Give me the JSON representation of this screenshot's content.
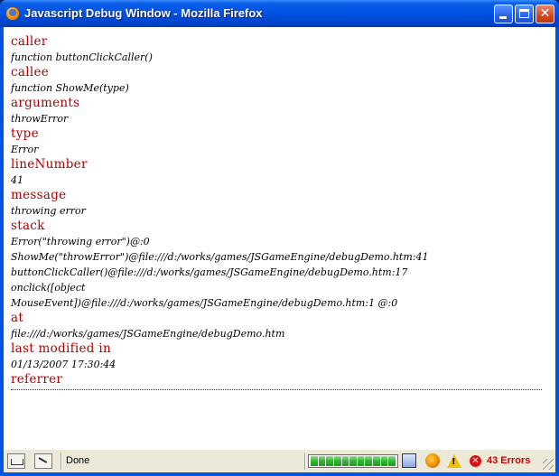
{
  "window": {
    "title": "Javascript Debug Window - Mozilla Firefox",
    "icons": {
      "app": "firefox-icon",
      "minimize": "minimize-icon",
      "maximize": "maximize-icon",
      "close": "close-icon"
    }
  },
  "debug": {
    "entries": [
      {
        "label": "caller",
        "lines": [
          "function buttonClickCaller()"
        ]
      },
      {
        "label": "callee",
        "lines": [
          "function ShowMe(type)"
        ]
      },
      {
        "label": "arguments",
        "lines": [
          "throwError"
        ]
      },
      {
        "label": "type",
        "lines": [
          "Error"
        ]
      },
      {
        "label": "lineNumber",
        "lines": [
          "41"
        ]
      },
      {
        "label": "message",
        "lines": [
          "throwing error"
        ]
      },
      {
        "label": "stack",
        "lines": [
          "Error(\"throwing error\")@:0",
          "ShowMe(\"throwError\")@file:///d:/works/games/JSGameEngine/debugDemo.htm:41",
          "buttonClickCaller()@file:///d:/works/games/JSGameEngine/debugDemo.htm:17",
          "onclick([object",
          "MouseEvent])@file:///d:/works/games/JSGameEngine/debugDemo.htm:1 @:0"
        ]
      },
      {
        "label": "at",
        "lines": [
          "file:///d:/works/games/JSGameEngine/debugDemo.htm"
        ]
      },
      {
        "label": "last modified in",
        "lines": [
          "01/13/2007 17:30:44"
        ]
      },
      {
        "label": "referrer",
        "lines": []
      }
    ]
  },
  "statusbar": {
    "status_text": "Done",
    "progress_fraction": 1.0,
    "progress_segments": 11,
    "errors_text": "43 Errors",
    "icons": [
      "layout-icon",
      "pen-icon",
      "network-icon",
      "firefox-icon",
      "warning-icon",
      "error-icon",
      "resize-grip-icon"
    ]
  },
  "colors": {
    "heading": "#b00000",
    "titlebar": "#0054e3",
    "error": "#d00000"
  }
}
